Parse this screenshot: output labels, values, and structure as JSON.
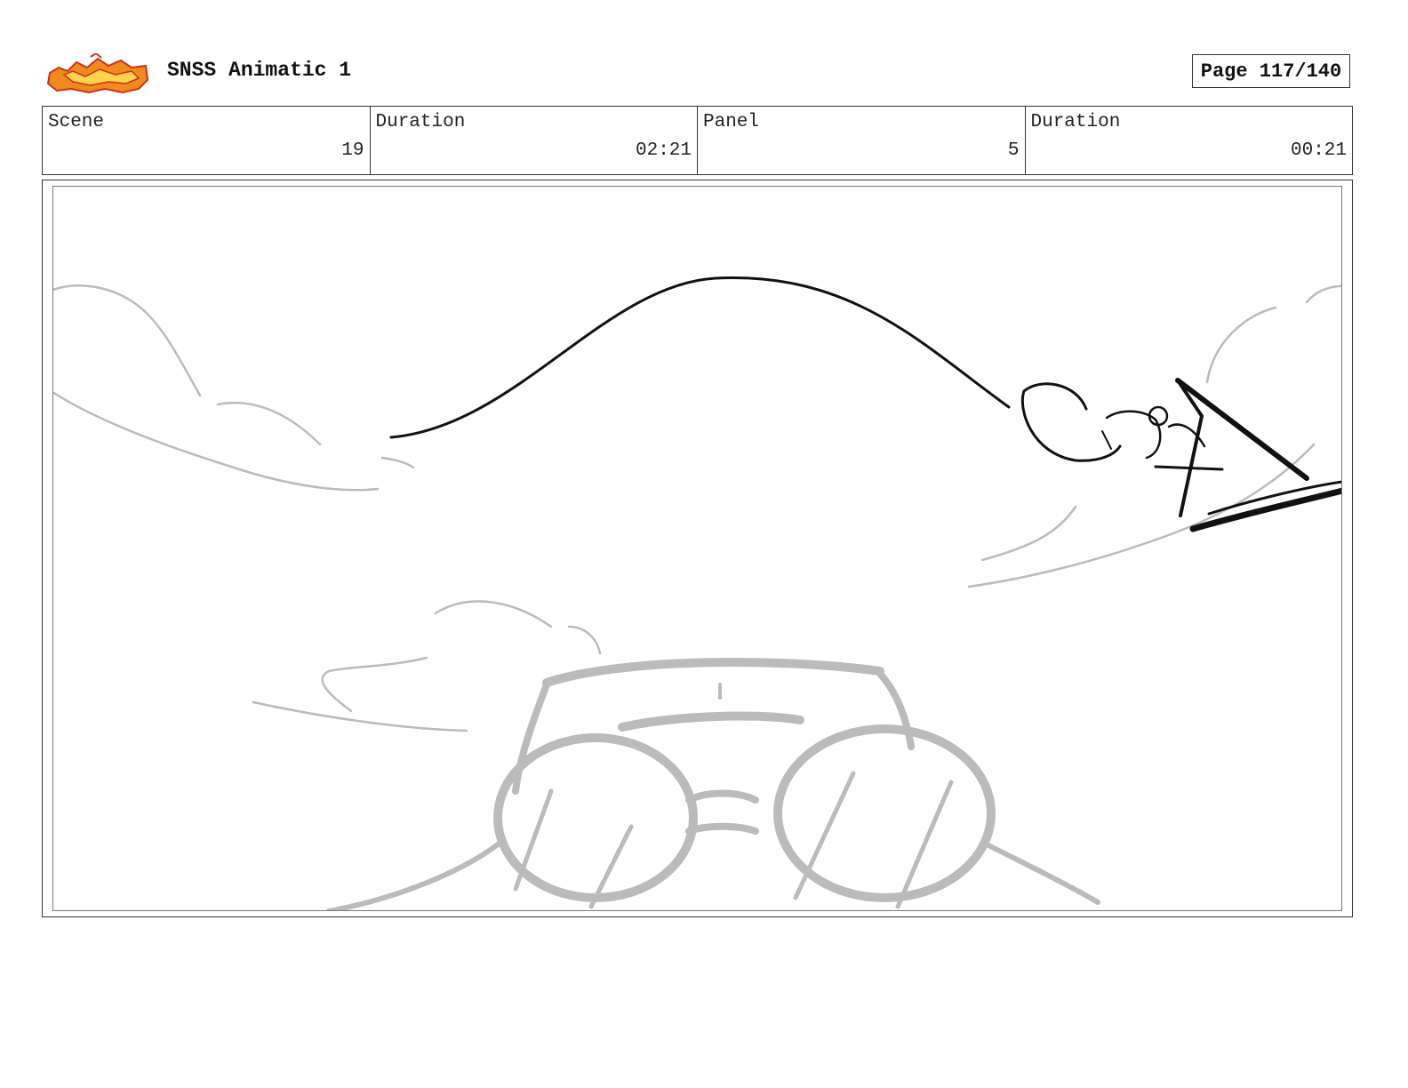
{
  "header": {
    "doc_title": "SNSS Animatic 1",
    "page_label": "Page 117/140",
    "logo_name": "sir-snap-a-lot-logo"
  },
  "info": {
    "scene_label": "Scene",
    "scene_value": "19",
    "scene_duration_label": "Duration",
    "scene_duration_value": "02:21",
    "panel_label": "Panel",
    "panel_value": "5",
    "panel_duration_label": "Duration",
    "panel_duration_value": "00:21"
  },
  "colors": {
    "sketch_dark": "#111111",
    "sketch_light": "#bbbbbb",
    "logo_orange": "#f08a1c",
    "logo_red": "#c8321e"
  }
}
